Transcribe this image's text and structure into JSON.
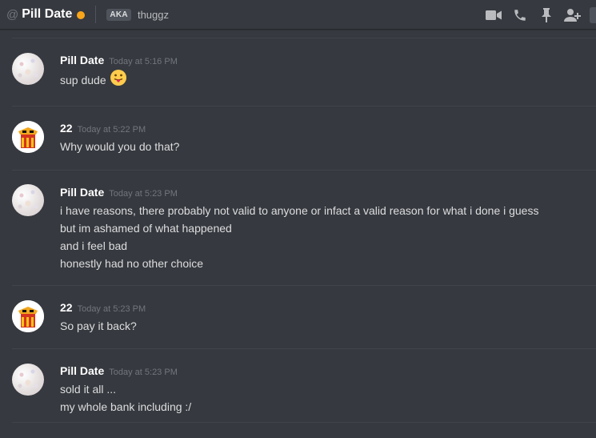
{
  "header": {
    "at_symbol": "@",
    "title": "Pill Date",
    "status_color": "#faa61a",
    "aka_badge": "AKA",
    "aka_name": "thuggz",
    "icons": [
      "video-call-icon",
      "voice-call-icon",
      "pinned-messages-icon",
      "add-friend-icon"
    ]
  },
  "messages": [
    {
      "username": "Pill Date",
      "timestamp": "Today at 5:16 PM",
      "avatar": "pill-avatar",
      "lines": [
        "sup dude"
      ],
      "emoji": "tongue-out-emoji"
    },
    {
      "username": "22",
      "timestamp": "Today at 5:22 PM",
      "avatar": "22-avatar",
      "lines": [
        "Why would you do that?"
      ]
    },
    {
      "username": "Pill Date",
      "timestamp": "Today at 5:23 PM",
      "avatar": "pill-avatar",
      "lines": [
        "i have reasons, there probably not valid to anyone or infact a valid reason for what i done i guess",
        "but im ashamed of what happened",
        "and i feel bad",
        "honestly had no other choice"
      ]
    },
    {
      "username": "22",
      "timestamp": "Today at 5:23 PM",
      "avatar": "22-avatar",
      "lines": [
        "So pay it back?"
      ]
    },
    {
      "username": "Pill Date",
      "timestamp": "Today at 5:23 PM",
      "avatar": "pill-avatar",
      "lines": [
        "sold it all ...",
        "my whole bank including :/"
      ]
    }
  ]
}
